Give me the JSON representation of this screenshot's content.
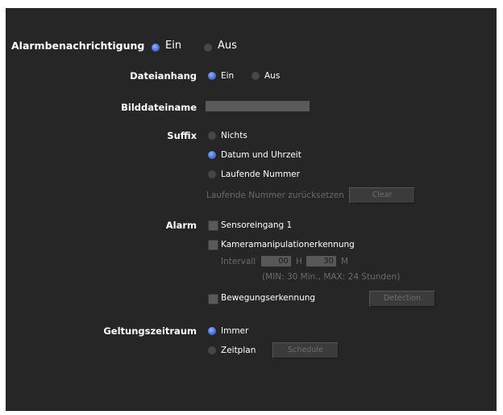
{
  "alarm_notification": {
    "label": "Alarmbenachrichtigung",
    "on": "Ein",
    "off": "Aus",
    "selected": "on"
  },
  "file_attachment": {
    "label": "Dateianhang",
    "on": "Ein",
    "off": "Aus",
    "selected": "on"
  },
  "image_filename": {
    "label": "Bilddateiname",
    "value": ""
  },
  "suffix": {
    "label": "Suffix",
    "options": [
      "Nichts",
      "Datum und Uhrzeit",
      "Laufende Nummer"
    ],
    "selected": "Datum und Uhrzeit",
    "reset_label": "Laufende Nummer zurücksetzen",
    "clear_button": "Clear"
  },
  "alarm": {
    "label": "Alarm",
    "sensor_input": "Sensoreingang 1",
    "tamper_detection": "Kameramanipulationerkennung",
    "interval_label": "Intervall",
    "interval_hours": "00",
    "hours_unit": "H",
    "interval_minutes": "30",
    "minutes_unit": "M",
    "range_note": "(MIN: 30 Min., MAX: 24 Stunden)",
    "motion_detection": "Bewegungserkennung",
    "detection_button": "Detection"
  },
  "validity_period": {
    "label": "Geltungszeitraum",
    "always": "Immer",
    "schedule": "Zeitplan",
    "selected": "always",
    "schedule_button": "Schedule"
  },
  "colors": {
    "panel_bg": "#262626",
    "radio_selected": "#4a73d9",
    "text": "#ffffff",
    "disabled_text": "#6a6a6a"
  }
}
